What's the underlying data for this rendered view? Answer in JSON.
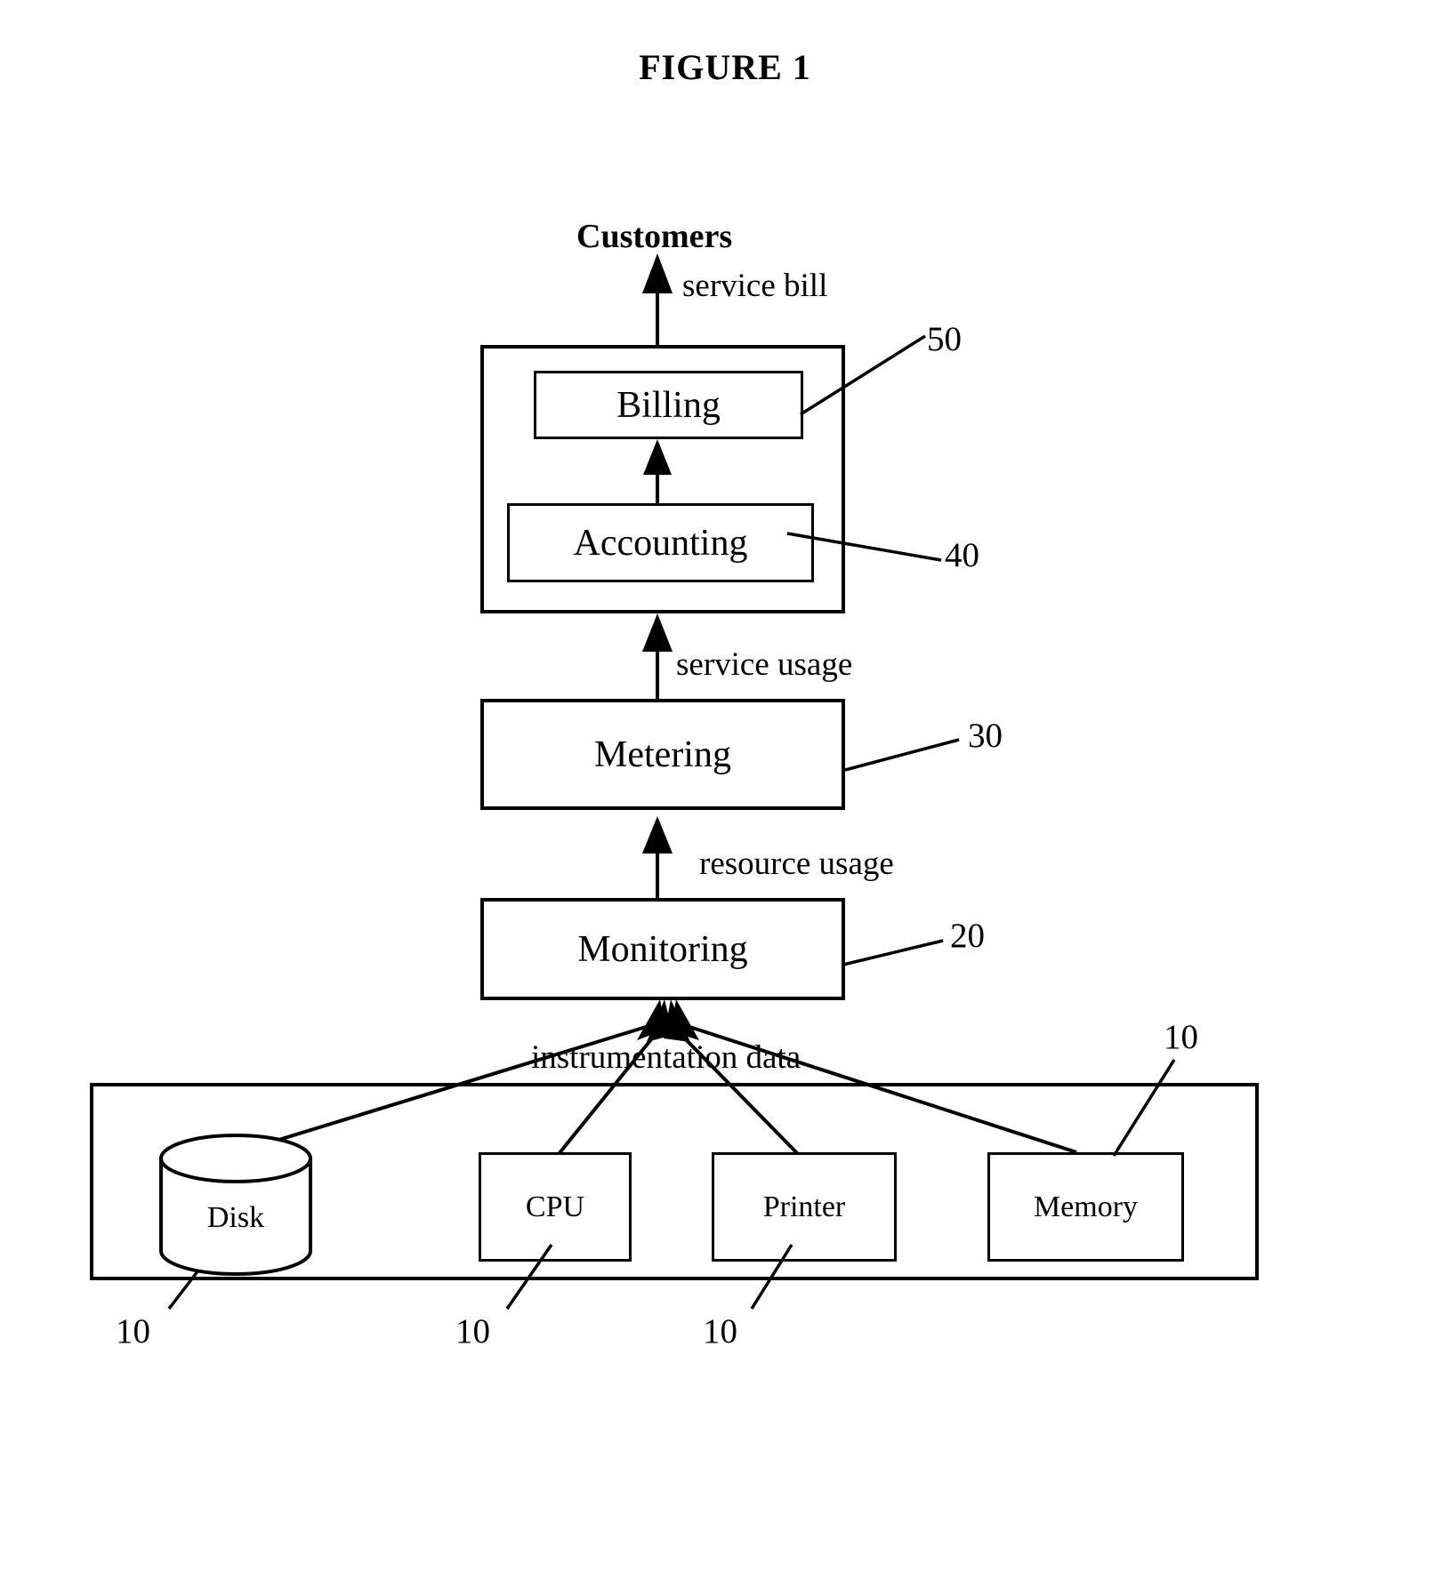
{
  "figure": {
    "title": "FIGURE 1"
  },
  "top": {
    "customers_label": "Customers",
    "service_bill_label": "service bill"
  },
  "billing_system": {
    "ref": "",
    "boxes": [
      {
        "label": "Billing",
        "ref": "50"
      },
      {
        "label": "Accounting",
        "ref": "40"
      }
    ]
  },
  "flows": {
    "service_usage": "service usage",
    "resource_usage": "resource usage",
    "instrumentation_data": "instrumentation data"
  },
  "stages": [
    {
      "label": "Metering",
      "ref": "30"
    },
    {
      "label": "Monitoring",
      "ref": "20"
    }
  ],
  "resources": {
    "container_ref": "10",
    "items": [
      {
        "label": "Disk",
        "ref": "10",
        "shape": "cylinder"
      },
      {
        "label": "CPU",
        "ref": "10",
        "shape": "rect"
      },
      {
        "label": "Printer",
        "ref": "10",
        "shape": "rect"
      },
      {
        "label": "Memory",
        "ref": "",
        "shape": "rect"
      }
    ]
  },
  "colors": {
    "ink": "#000000",
    "paper": "#ffffff"
  }
}
